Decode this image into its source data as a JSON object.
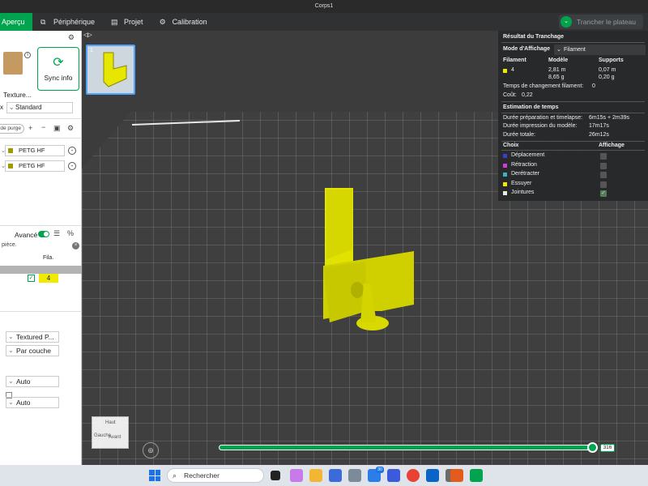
{
  "window": {
    "title": "Corps1"
  },
  "nav": {
    "tabs": [
      {
        "label": "Aperçu",
        "icon": "preview-icon"
      },
      {
        "label": "Périphérique",
        "icon": "device-icon"
      },
      {
        "label": "Projet",
        "icon": "project-icon"
      },
      {
        "label": "Calibration",
        "icon": "calibration-icon"
      }
    ],
    "slice_button": "Trancher le plateau"
  },
  "left": {
    "texture_label": "Texture...",
    "sync_label": "Sync info",
    "x_prefix": "x",
    "process_preset": "Standard",
    "purge_label": "de purge",
    "filaments": [
      "PETG HF",
      "PETG HF"
    ],
    "advanced_label": "Avancé",
    "search_text": "pièce.",
    "fila_header": "Fila.",
    "object_filament": "4",
    "settings": [
      "Textured P...",
      "Par couche",
      "Auto",
      "Auto"
    ]
  },
  "results": {
    "title": "Résultat du Tranchage",
    "mode_label": "Mode d'Affichage",
    "mode_value": "Filament",
    "col_filament": "Filament",
    "col_model": "Modèle",
    "col_supports": "Supports",
    "fil_num": "4",
    "model_len": "2,81 m",
    "model_weight": "8,65 g",
    "sup_len": "0,07 m",
    "sup_weight": "0,20 g",
    "change_time_label": "Temps de changement filament:",
    "change_time_value": "0",
    "cost_label": "Coût:",
    "cost_value": "0,22",
    "time_title": "Estimation de temps",
    "prep_label": "Durée préparation et timelapse:",
    "prep_value": "6m15s + 2m39s",
    "print_label": "Durée impression du modèle:",
    "print_value": "17m17s",
    "total_label": "Durée totale:",
    "total_value": "26m12s",
    "choice_header": "Choix",
    "display_header": "Affichage",
    "legend": [
      {
        "label": "Déplacement",
        "color": "#3b3bd6",
        "shown": false
      },
      {
        "label": "Rétraction",
        "color": "#d63bd6",
        "shown": false
      },
      {
        "label": "Derétracter",
        "color": "#3bb0c6",
        "shown": false
      },
      {
        "label": "Essuyer",
        "color": "#f0e800",
        "shown": false
      },
      {
        "label": "Jointures",
        "color": "#e8e8e8",
        "shown": true
      }
    ]
  },
  "viewport": {
    "thumb_index": "1",
    "layer_value": "316",
    "layer_progress": 1.0,
    "viewcube": {
      "top": "Haut",
      "front": "Avant",
      "left": "Gauche"
    }
  },
  "taskbar": {
    "search_placeholder": "Rechercher",
    "badge_count": "30"
  },
  "colors": {
    "accent": "#00a44f",
    "model": "#e6e600"
  }
}
